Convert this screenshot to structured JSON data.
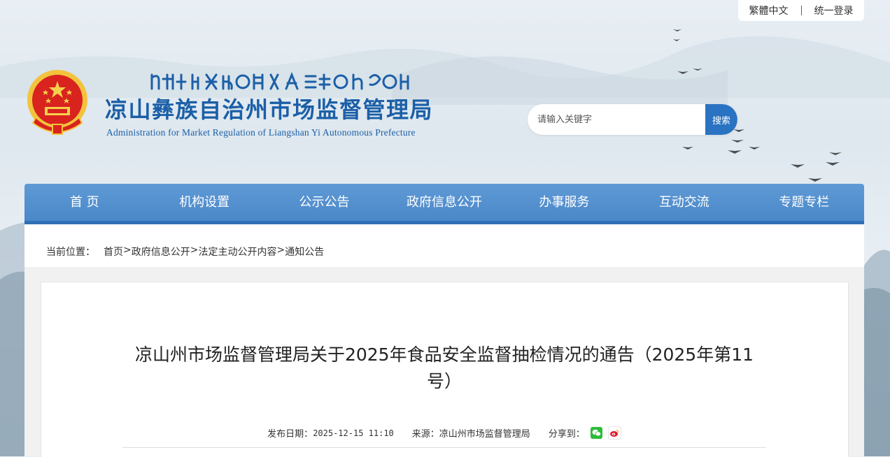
{
  "topbar": {
    "traditional": "繁體中文",
    "login": "统一登录"
  },
  "header": {
    "title_cn": "凉山彝族自治州市场监督管理局",
    "title_en": "Administration for Market Regulation of Liangshan Yi Autonomous Prefecture"
  },
  "search": {
    "placeholder": "请输入关键字",
    "button": "搜索"
  },
  "nav": {
    "items": [
      "首 页",
      "机构设置",
      "公示公告",
      "政府信息公开",
      "办事服务",
      "互动交流",
      "专题专栏"
    ]
  },
  "breadcrumb": {
    "label": "当前位置：",
    "items": [
      "首页",
      "政府信息公开",
      "法定主动公开内容",
      "通知公告"
    ],
    "sep": ">"
  },
  "article": {
    "title": "凉山州市场监督管理局关于2025年食品安全监督抽检情况的通告（2025年第11号）",
    "date_label": "发布日期：",
    "date": "2025-12-15 11:10",
    "source_label": "来源：",
    "source": "凉山州市场监督管理局",
    "share_label": "分享到："
  },
  "colors": {
    "nav": "#4b88c8",
    "title": "#1b5fa7",
    "search_btn": "#2a73c2"
  }
}
